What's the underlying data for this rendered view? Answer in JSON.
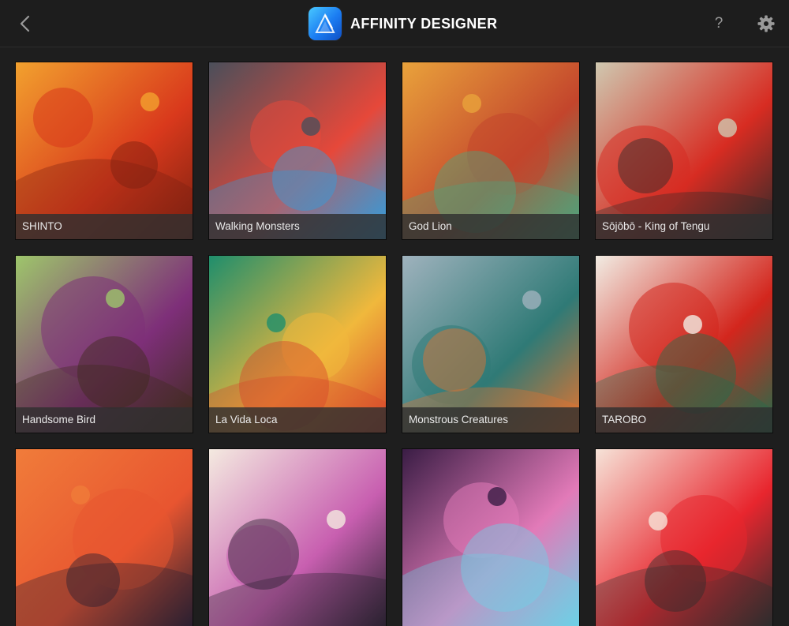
{
  "header": {
    "app_title": "AFFINITY DESIGNER",
    "back_icon": "chevron-left-icon",
    "help_label": "?",
    "settings_icon": "gear-icon",
    "logo_icon": "affinity-designer-logo",
    "logo_colors": [
      "#49c9ff",
      "#1b7cf2",
      "#0f4fc4"
    ]
  },
  "gallery": {
    "items": [
      {
        "title": "SHINTO",
        "palette": [
          "#f2a12e",
          "#d9391c",
          "#7a2010"
        ]
      },
      {
        "title": "Walking Monsters",
        "palette": [
          "#4b4f5a",
          "#e6483a",
          "#2f9fe0"
        ]
      },
      {
        "title": "God Lion",
        "palette": [
          "#e9a23b",
          "#c3452c",
          "#4aa77e"
        ]
      },
      {
        "title": "Sōjōbō - King of Tengu",
        "palette": [
          "#cfc8b0",
          "#d72c22",
          "#2a2a2a"
        ]
      },
      {
        "title": "Handsome Bird",
        "palette": [
          "#9ec66b",
          "#7e2f79",
          "#3d2b1a"
        ]
      },
      {
        "title": "La Vida Loca",
        "palette": [
          "#1f8e6c",
          "#f0b83c",
          "#d8462a"
        ]
      },
      {
        "title": "Monstrous Creatures",
        "palette": [
          "#9fb2bd",
          "#2f7a76",
          "#e8742e"
        ]
      },
      {
        "title": "TAROBO",
        "palette": [
          "#f1ece3",
          "#d3261d",
          "#1f6e4c"
        ]
      },
      {
        "title": "",
        "palette": [
          "#f07c3a",
          "#e85530",
          "#2b2030"
        ]
      },
      {
        "title": "",
        "palette": [
          "#f4eae0",
          "#c85fb0",
          "#2a2130"
        ]
      },
      {
        "title": "",
        "palette": [
          "#3a1d45",
          "#e27ab8",
          "#6ed0e6"
        ]
      },
      {
        "title": "",
        "palette": [
          "#f6e3d8",
          "#e8262e",
          "#2d2d2d"
        ]
      }
    ]
  }
}
